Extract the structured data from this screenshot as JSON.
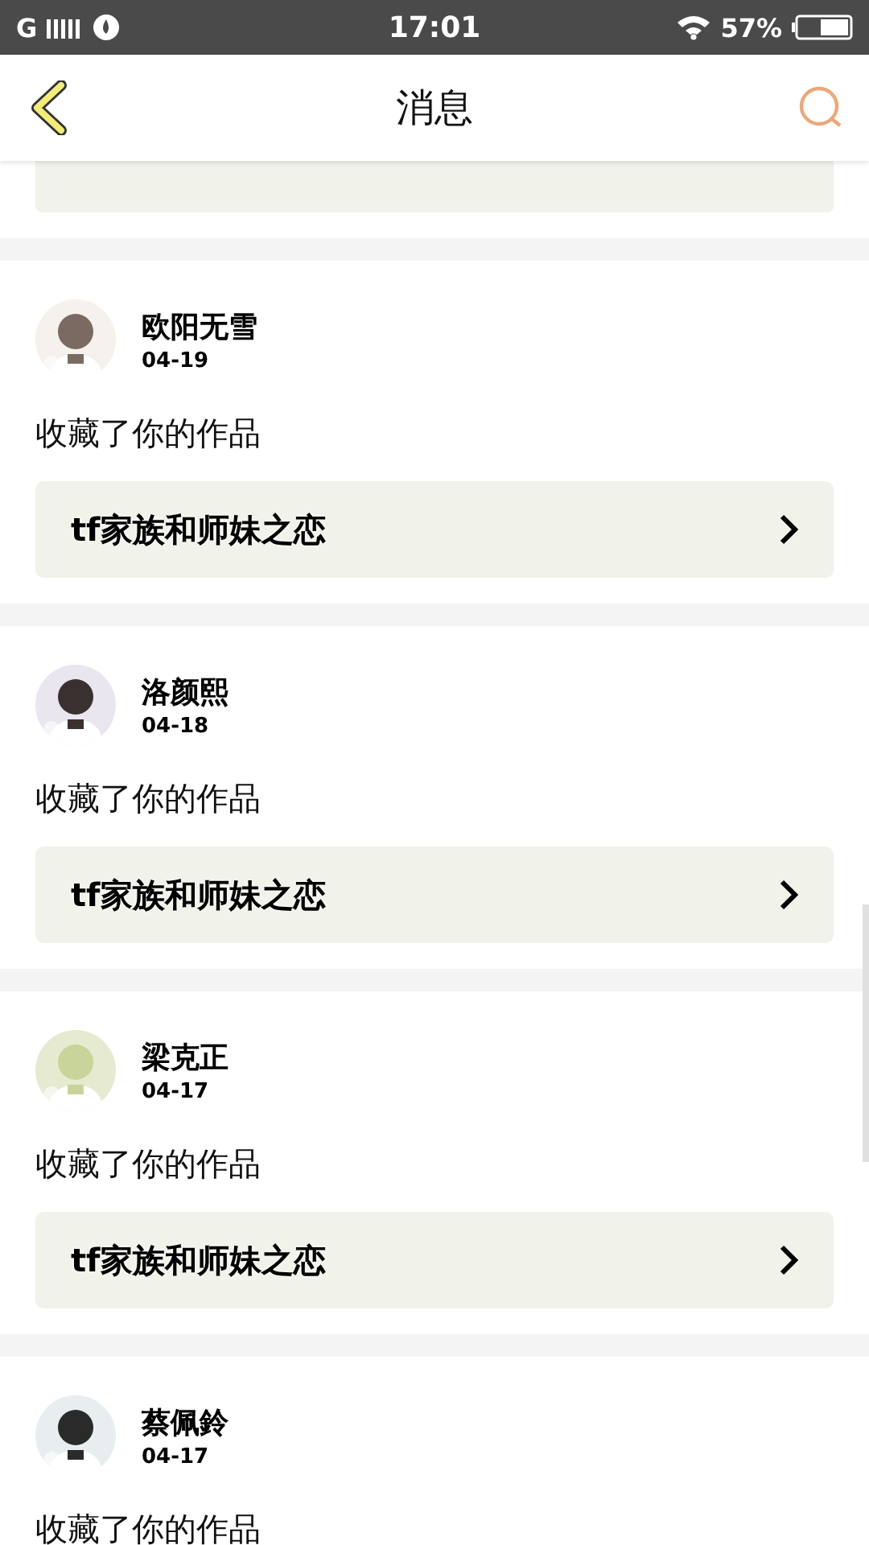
{
  "status_bar": {
    "network": "G",
    "time": "17:01",
    "battery": "57%"
  },
  "header": {
    "title": "消息"
  },
  "messages": [
    {
      "name": "欧阳无雪",
      "date": "04-19",
      "action": "收藏了你的作品",
      "work": "tf家族和师妹之恋"
    },
    {
      "name": "洛颜熙",
      "date": "04-18",
      "action": "收藏了你的作品",
      "work": "tf家族和师妹之恋"
    },
    {
      "name": "梁克正",
      "date": "04-17",
      "action": "收藏了你的作品",
      "work": "tf家族和师妹之恋"
    },
    {
      "name": "蔡佩鈴",
      "date": "04-17",
      "action": "收藏了你的作品"
    }
  ]
}
